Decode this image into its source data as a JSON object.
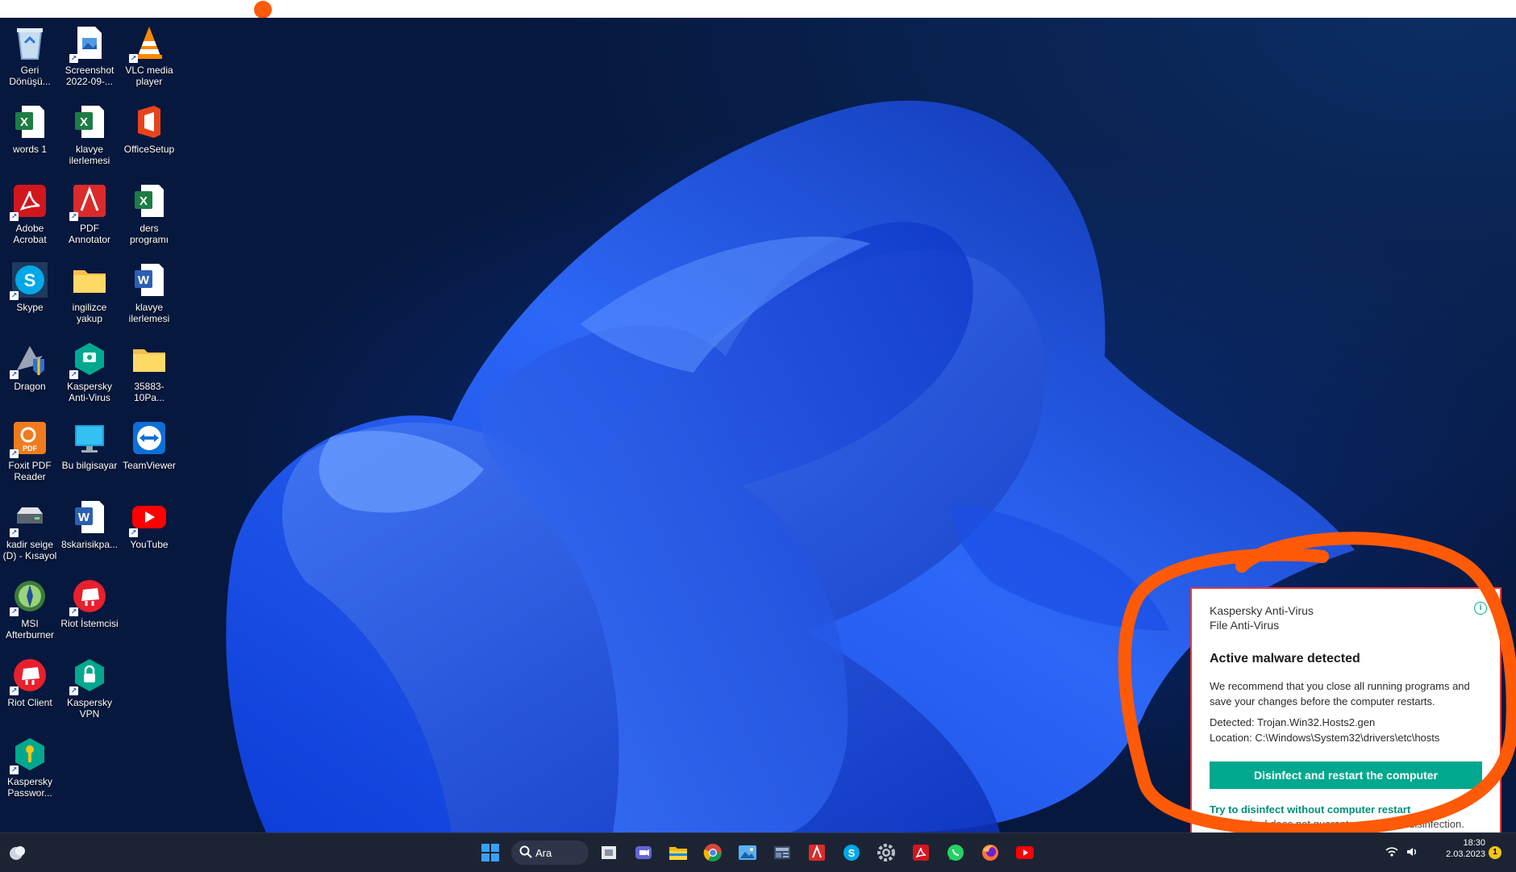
{
  "desktop_icons": [
    {
      "label": "Geri Dönüşü...",
      "icon": "recycle-bin-icon"
    },
    {
      "label": "Screenshot 2022-09-...",
      "icon": "image-file-icon"
    },
    {
      "label": "VLC media player",
      "icon": "vlc-icon"
    },
    {
      "label": "words 1",
      "icon": "excel-icon"
    },
    {
      "label": "klavye ilerlemesi",
      "icon": "excel-icon"
    },
    {
      "label": "OfficeSetup",
      "icon": "office-icon"
    },
    {
      "label": "Adobe Acrobat",
      "icon": "acrobat-icon"
    },
    {
      "label": "PDF Annotator",
      "icon": "pdf-annotator-icon"
    },
    {
      "label": "ders programı",
      "icon": "excel-icon"
    },
    {
      "label": "Skype",
      "icon": "skype-icon"
    },
    {
      "label": "ingilizce yakup",
      "icon": "folder-icon"
    },
    {
      "label": "klavye ilerlemesi",
      "icon": "word-icon"
    },
    {
      "label": "Dragon",
      "icon": "dragon-icon"
    },
    {
      "label": "Kaspersky Anti-Virus",
      "icon": "kaspersky-icon"
    },
    {
      "label": "35883-10Pa...",
      "icon": "folder-icon"
    },
    {
      "label": "Foxit PDF Reader",
      "icon": "foxit-icon"
    },
    {
      "label": "Bu bilgisayar",
      "icon": "computer-icon"
    },
    {
      "label": "TeamViewer",
      "icon": "teamviewer-icon"
    },
    {
      "label": "kadir seige (D) - Kısayol",
      "icon": "drive-icon"
    },
    {
      "label": "8skarisikpa...",
      "icon": "word-icon"
    },
    {
      "label": "YouTube",
      "icon": "youtube-icon"
    },
    {
      "label": "MSI Afterburner",
      "icon": "msi-afterburner-icon"
    },
    {
      "label": "Riot İstemcisi",
      "icon": "riot-icon"
    },
    {
      "label": "Riot Client",
      "icon": "riot-icon"
    },
    {
      "label": "Kaspersky VPN",
      "icon": "kaspersky-vpn-icon"
    },
    {
      "label": "Kaspersky Passwor...",
      "icon": "kaspersky-password-icon"
    }
  ],
  "taskbar": {
    "search_label": "Ara",
    "apps": [
      "start-icon",
      "search-icon",
      "task-view-icon",
      "teams-icon",
      "file-explorer-icon",
      "chrome-icon",
      "photos-icon",
      "news-icon",
      "pdf-annotator-icon",
      "skype-icon",
      "settings-icon",
      "acrobat-icon",
      "whatsapp-icon",
      "firefox-icon",
      "youtube-icon"
    ],
    "time": "18:30",
    "date": "2.03.2023",
    "notification_count": "1"
  },
  "notification": {
    "app_name": "Kaspersky Anti-Virus",
    "component": "File Anti-Virus",
    "title": "Active malware detected",
    "message": "We recommend that you close all running programs and save your changes before the computer restarts.",
    "detected_label": "Detected: Trojan.Win32.Hosts2.gen",
    "location_label": "Location:  C:\\Windows\\System32\\drivers\\etc\\hosts",
    "primary_button": "Disinfect and restart the computer",
    "secondary_link": "Try to disinfect without computer restart",
    "secondary_note": "This method does not guarantee complete disinfection.",
    "accent_color": "#00a88e"
  },
  "annotation_color": "#ff5a08"
}
